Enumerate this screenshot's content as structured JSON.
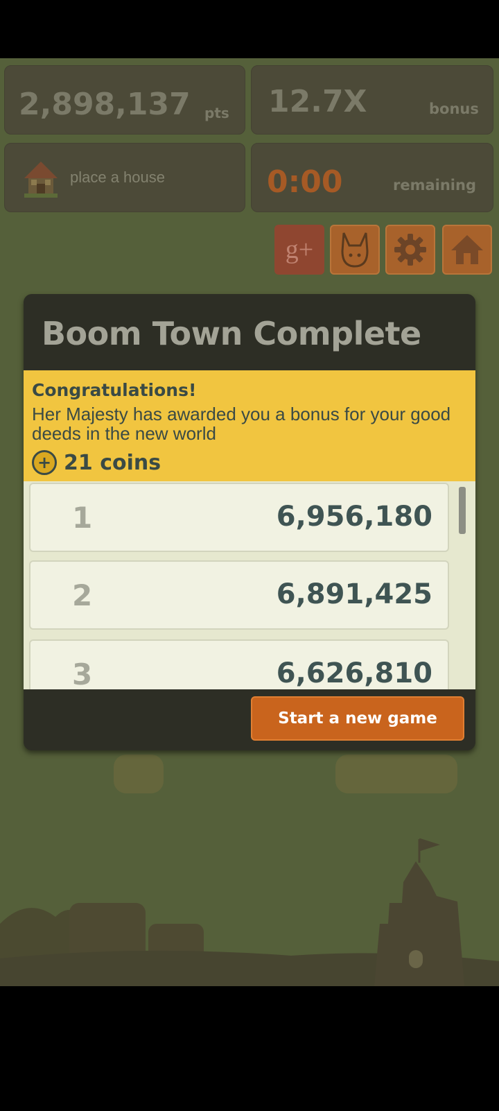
{
  "hud": {
    "points_value": "2,898,137",
    "points_label": "pts",
    "bonus_value": "12.7X",
    "bonus_label": "bonus",
    "place_house_label": "place a house",
    "timer_value": "0:00",
    "timer_label": "remaining"
  },
  "toolbar": {
    "gplus_label": "g+"
  },
  "dialog": {
    "title": "Boom Town Complete",
    "banner_heading": "Congratulations!",
    "banner_text": "Her Majesty has awarded you a bonus for your good deeds in the new world",
    "coins_label": "21 coins",
    "coin_icon_glyph": "+",
    "scores": [
      {
        "rank": "1",
        "score": "6,956,180"
      },
      {
        "rank": "2",
        "score": "6,891,425"
      },
      {
        "rank": "3",
        "score": "6,626,810"
      }
    ],
    "new_game_label": "Start a new game"
  },
  "colors": {
    "banner": "#f1c540",
    "button": "#c9641d",
    "timer": "#a65a25"
  }
}
